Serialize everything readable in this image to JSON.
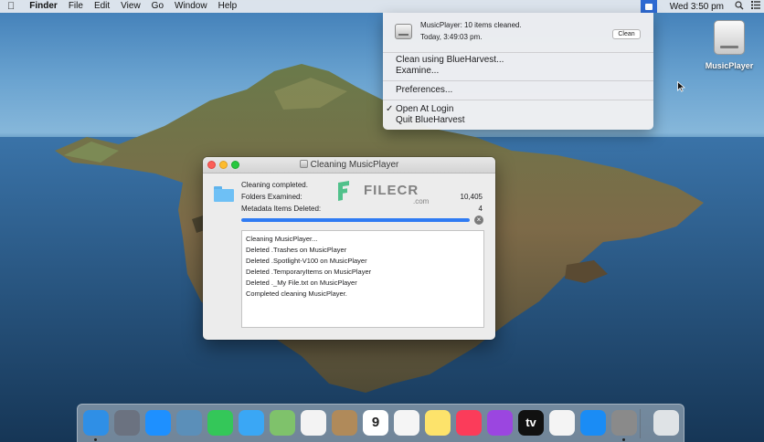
{
  "menubar": {
    "apple_icon": "apple-logo-icon",
    "app_name": "Finder",
    "menus": [
      "File",
      "Edit",
      "View",
      "Go",
      "Window",
      "Help"
    ],
    "clock": "Wed 3:50 pm",
    "status_icons": [
      "blueharvest-status-icon",
      "spotlight-search-icon",
      "control-list-icon"
    ]
  },
  "status_menu": {
    "line1": "MusicPlayer: 10 items cleaned.",
    "line2": "Today,  3:49:03 pm.",
    "clean_button": "Clean",
    "items": {
      "clean_using": "Clean using BlueHarvest...",
      "examine": "Examine...",
      "preferences": "Preferences...",
      "open_at_login": "Open At Login",
      "quit": "Quit BlueHarvest"
    },
    "open_at_login_checked": true,
    "checkmark": "✓"
  },
  "desktop": {
    "disk_label": "MusicPlayer"
  },
  "cleaning_window": {
    "title": "Cleaning MusicPlayer",
    "status": "Cleaning completed.",
    "folders_label": "Folders Examined:",
    "folders_value": "10,405",
    "metadata_label": "Metadata Items Deleted:",
    "metadata_value": "4",
    "progress": 1.0,
    "stop_glyph": "×",
    "log": [
      "Cleaning MusicPlayer...",
      "Deleted .Trashes on MusicPlayer",
      "Deleted .Spotlight-V100 on MusicPlayer",
      "Deleted .TemporaryItems on MusicPlayer",
      "Deleted ._My File.txt on MusicPlayer",
      "Completed cleaning MusicPlayer."
    ]
  },
  "watermark": {
    "word": "FILECR",
    "suffix": ".com"
  },
  "dock": {
    "apps": [
      {
        "name": "finder-icon",
        "color": "#2f8fe6",
        "glyph": ""
      },
      {
        "name": "launchpad-icon",
        "color": "#6b7280",
        "glyph": ""
      },
      {
        "name": "safari-icon",
        "color": "#1e90ff",
        "glyph": ""
      },
      {
        "name": "preview-icon",
        "color": "#5b8fb9",
        "glyph": ""
      },
      {
        "name": "facetime-icon",
        "color": "#34c759",
        "glyph": ""
      },
      {
        "name": "messages-icon",
        "color": "#3aa7f5",
        "glyph": ""
      },
      {
        "name": "maps-icon",
        "color": "#7fc26b",
        "glyph": ""
      },
      {
        "name": "photos-icon",
        "color": "#f3f3f3",
        "glyph": ""
      },
      {
        "name": "contacts-icon",
        "color": "#b08a5a",
        "glyph": ""
      },
      {
        "name": "calendar-icon",
        "color": "#ffffff",
        "glyph": "9"
      },
      {
        "name": "reminders-icon",
        "color": "#f5f5f5",
        "glyph": ""
      },
      {
        "name": "notes-icon",
        "color": "#fde36b",
        "glyph": ""
      },
      {
        "name": "music-icon",
        "color": "#fb3c5a",
        "glyph": ""
      },
      {
        "name": "podcasts-icon",
        "color": "#9b46e0",
        "glyph": ""
      },
      {
        "name": "tv-icon",
        "color": "#111111",
        "glyph": "tv"
      },
      {
        "name": "news-icon",
        "color": "#f4f4f4",
        "glyph": ""
      },
      {
        "name": "app-store-icon",
        "color": "#1a8cf5",
        "glyph": ""
      },
      {
        "name": "system-preferences-icon",
        "color": "#8a8a8a",
        "glyph": ""
      },
      {
        "name": "trash-icon",
        "color": "#dfe3e6",
        "glyph": ""
      }
    ]
  },
  "colors": {
    "accent": "#2f7bf3",
    "status_icon_bg": "#2e6ad2"
  }
}
